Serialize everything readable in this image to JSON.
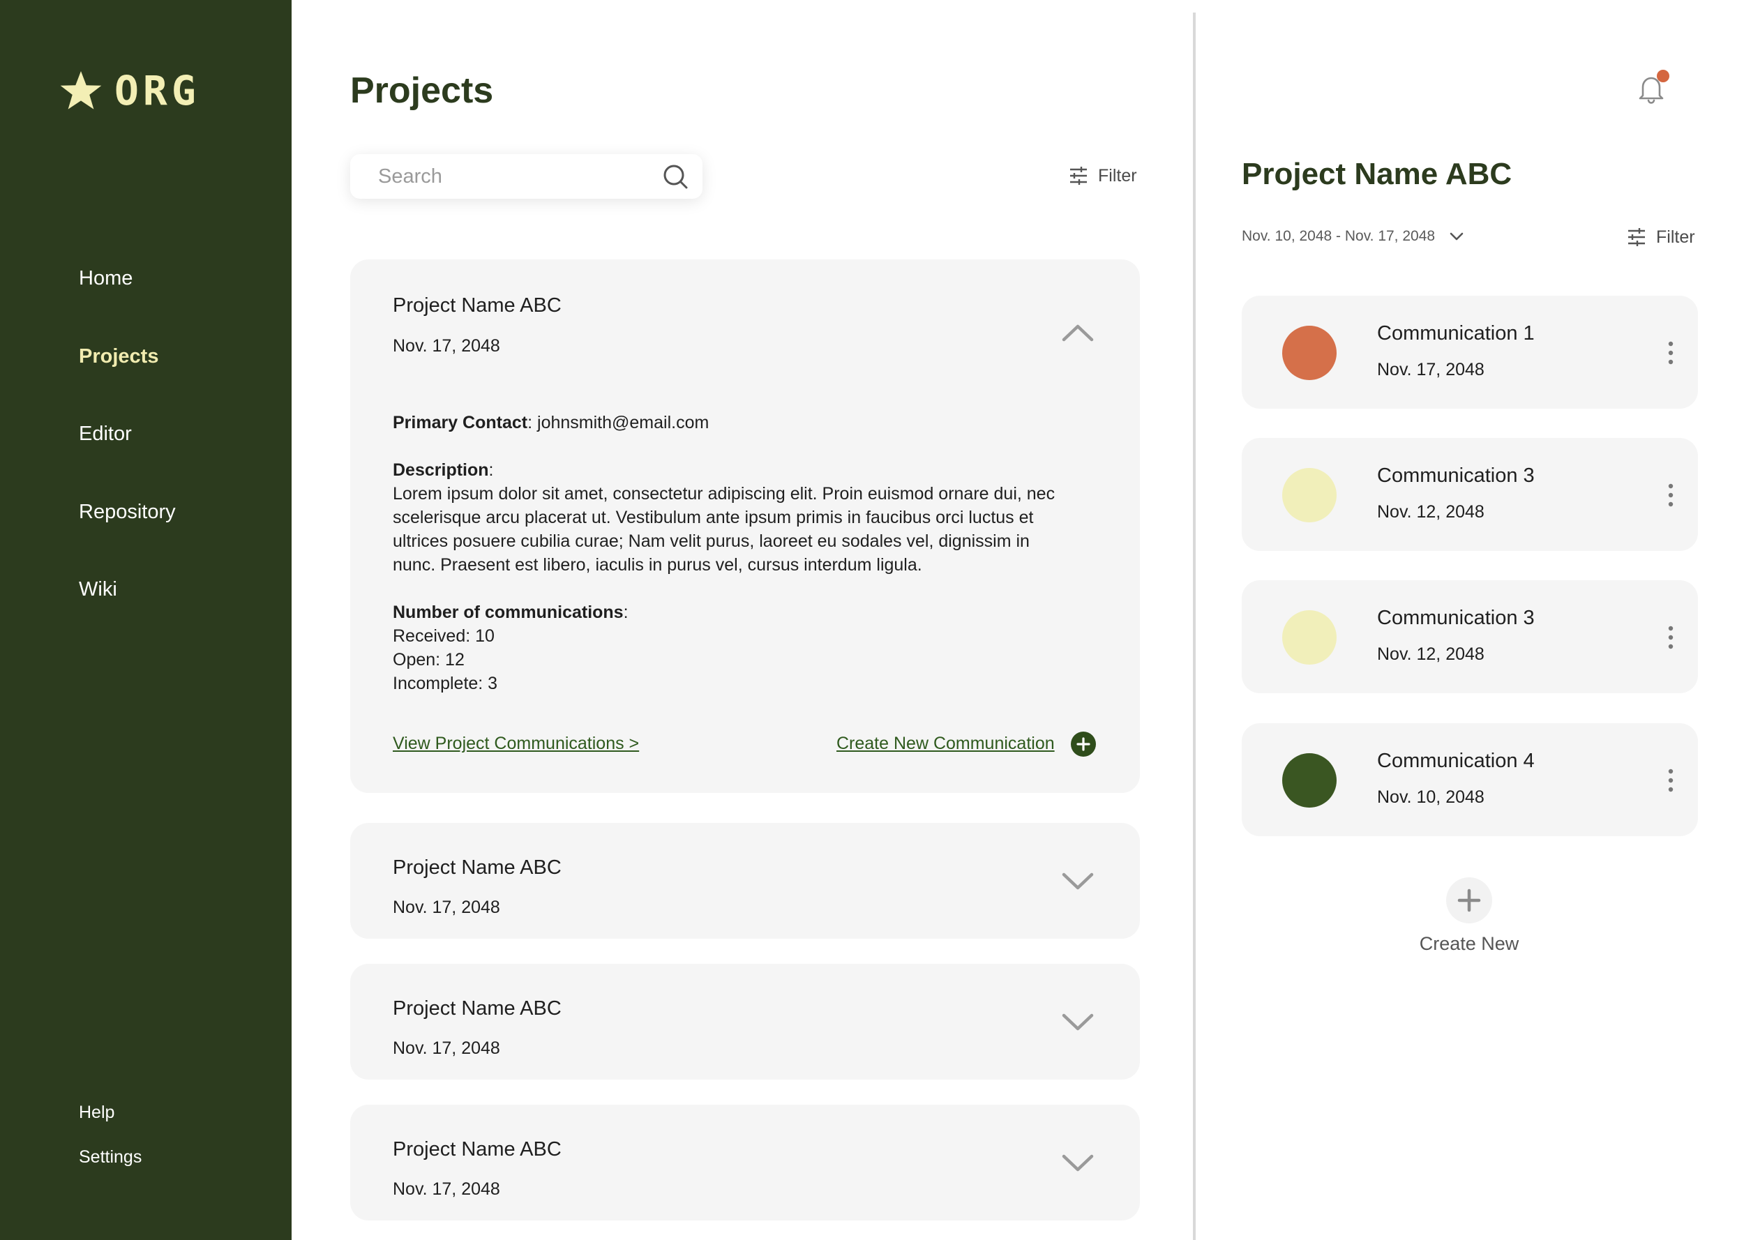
{
  "brand": {
    "logo_text": "ORG"
  },
  "sidebar": {
    "items": [
      {
        "label": "Home"
      },
      {
        "label": "Projects"
      },
      {
        "label": "Editor"
      },
      {
        "label": "Repository"
      },
      {
        "label": "Wiki"
      }
    ],
    "bottom": [
      {
        "label": "Help"
      },
      {
        "label": "Settings"
      }
    ]
  },
  "main": {
    "title": "Projects",
    "search": {
      "placeholder": "Search",
      "value": ""
    },
    "filter_label": "Filter",
    "projects": [
      {
        "name": "Project Name ABC",
        "date": "Nov. 17, 2048",
        "expanded": true,
        "primary_contact_label": "Primary Contact",
        "primary_contact": "johnsmith@email.com",
        "description_label": "Description",
        "description": "Lorem ipsum dolor sit amet, consectetur adipiscing elit. Proin euismod ornare dui, nec scelerisque arcu placerat ut. Vestibulum ante ipsum primis in faucibus orci luctus et ultrices posuere cubilia curae; Nam velit purus, laoreet eu sodales vel, dignissim in nunc. Praesent est libero, iaculis in purus vel, cursus interdum ligula.",
        "comms_label": "Number of communications",
        "received": "Received: 10",
        "open": "Open: 12",
        "incomplete": "Incomplete: 3",
        "view_link": "View Project Communications >",
        "create_link": "Create New Communication"
      },
      {
        "name": "Project Name ABC",
        "date": "Nov. 17, 2048",
        "expanded": false
      },
      {
        "name": "Project Name ABC",
        "date": "Nov. 17, 2048",
        "expanded": false
      },
      {
        "name": "Project Name ABC",
        "date": "Nov. 17, 2048",
        "expanded": false
      }
    ]
  },
  "panel": {
    "title": "Project Name ABC",
    "date_range": "Nov. 10, 2048 - Nov. 17, 2048",
    "filter_label": "Filter",
    "communications": [
      {
        "title": "Communication 1",
        "date": "Nov. 17, 2048",
        "color": "#d5704a"
      },
      {
        "title": "Communication 3",
        "date": "Nov. 12, 2048",
        "color": "#f1efba"
      },
      {
        "title": "Communication 3",
        "date": "Nov. 12, 2048",
        "color": "#f1efba"
      },
      {
        "title": "Communication 4",
        "date": "Nov. 10, 2048",
        "color": "#3a5622"
      }
    ],
    "create_new_label": "Create New"
  },
  "colors": {
    "sidebar_bg": "#2c3b1e",
    "accent_yellow": "#f1ecb0",
    "link_green": "#2f5a1e",
    "notification_dot": "#d4663f"
  },
  "icons": [
    "star-icon",
    "search-icon",
    "filter-icon",
    "chevron-up-icon",
    "chevron-down-icon",
    "plus-icon",
    "bell-icon",
    "kebab-icon"
  ]
}
